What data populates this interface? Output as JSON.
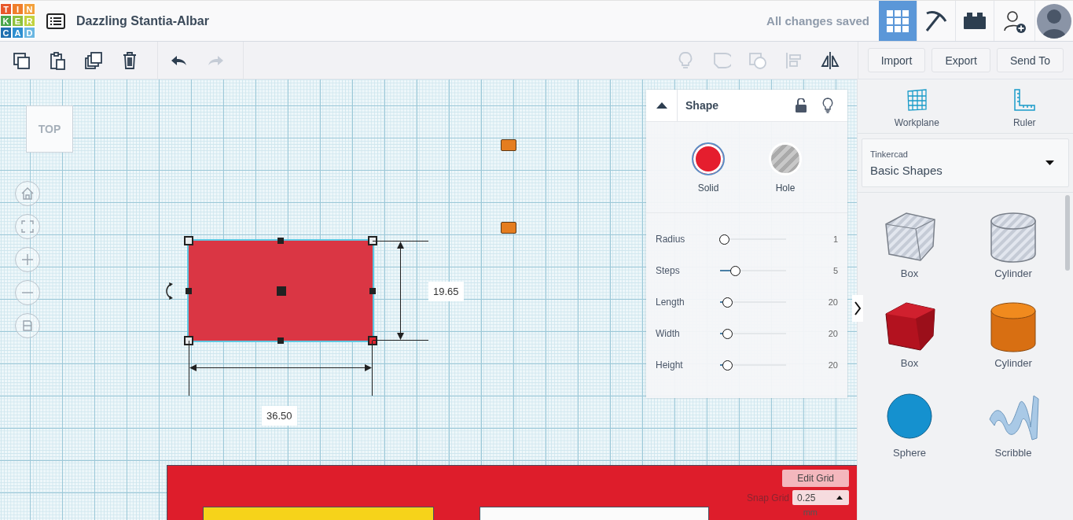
{
  "header": {
    "logo": [
      {
        "letter": "T",
        "color": "#e8582c"
      },
      {
        "letter": "I",
        "color": "#ef7e2b"
      },
      {
        "letter": "N",
        "color": "#f3a13d"
      },
      {
        "letter": "K",
        "color": "#4aa64a"
      },
      {
        "letter": "E",
        "color": "#8fc13e"
      },
      {
        "letter": "R",
        "color": "#c2d240"
      },
      {
        "letter": "C",
        "color": "#1f6fb0"
      },
      {
        "letter": "A",
        "color": "#2e8fd0"
      },
      {
        "letter": "D",
        "color": "#6bb7e2"
      }
    ],
    "title": "Dazzling Stantia-Albar",
    "save_status": "All changes saved",
    "views": [
      {
        "kind": "grid",
        "selected": true
      },
      {
        "kind": "pickaxe",
        "selected": false
      },
      {
        "kind": "brick",
        "selected": false
      }
    ]
  },
  "toolbar": {
    "edit_tools": [
      {
        "kind": "copy",
        "disabled": false
      },
      {
        "kind": "paste",
        "disabled": false
      },
      {
        "kind": "duplicate",
        "disabled": false
      },
      {
        "kind": "delete",
        "disabled": false
      }
    ],
    "history_tools": [
      {
        "kind": "undo",
        "disabled": false
      },
      {
        "kind": "redo",
        "disabled": true
      }
    ],
    "shape_tools": [
      {
        "kind": "bulb",
        "disabled": true
      },
      {
        "kind": "group",
        "disabled": true
      },
      {
        "kind": "ungroup",
        "disabled": true
      },
      {
        "kind": "align",
        "disabled": true
      },
      {
        "kind": "mirror",
        "disabled": false
      }
    ],
    "buttons": [
      "Import",
      "Export",
      "Send To"
    ]
  },
  "canvas": {
    "view_cube": "TOP",
    "nav": [
      {
        "kind": "home"
      },
      {
        "kind": "fit"
      },
      {
        "kind": "zoom-in"
      },
      {
        "kind": "zoom-out"
      },
      {
        "kind": "ortho"
      }
    ],
    "height_dimension": "19.65",
    "width_dimension": "36.50",
    "shape_panel": {
      "title": "Shape",
      "modes": [
        {
          "label": "Solid",
          "selected": true
        },
        {
          "label": "Hole",
          "selected": false
        }
      ],
      "params": [
        {
          "label": "Radius",
          "level": 0,
          "value": "1"
        },
        {
          "label": "Steps",
          "level": 0.17,
          "value": "5"
        },
        {
          "label": "Length",
          "level": 0.05,
          "value": "20"
        },
        {
          "label": "Width",
          "level": 0.05,
          "value": "20"
        },
        {
          "label": "Height",
          "level": 0.05,
          "value": "20"
        }
      ]
    },
    "edit_grid": "Edit Grid",
    "snap_grid": {
      "label": "Snap Grid",
      "value": "0.25",
      "unit": "mm"
    }
  },
  "sidebar": {
    "tools": [
      {
        "kind": "workplane",
        "label": "Workplane"
      },
      {
        "kind": "ruler",
        "label": "Ruler"
      }
    ],
    "library": {
      "caption": "Tinkercad",
      "value": "Basic Shapes"
    },
    "shapes": [
      {
        "kind": "box-hole",
        "label": "Box"
      },
      {
        "kind": "cylinder-hole",
        "label": "Cylinder"
      },
      {
        "kind": "box",
        "label": "Box"
      },
      {
        "kind": "cylinder",
        "label": "Cylinder"
      },
      {
        "kind": "sphere",
        "label": "Sphere"
      },
      {
        "kind": "scribble",
        "label": "Scribble"
      }
    ]
  }
}
